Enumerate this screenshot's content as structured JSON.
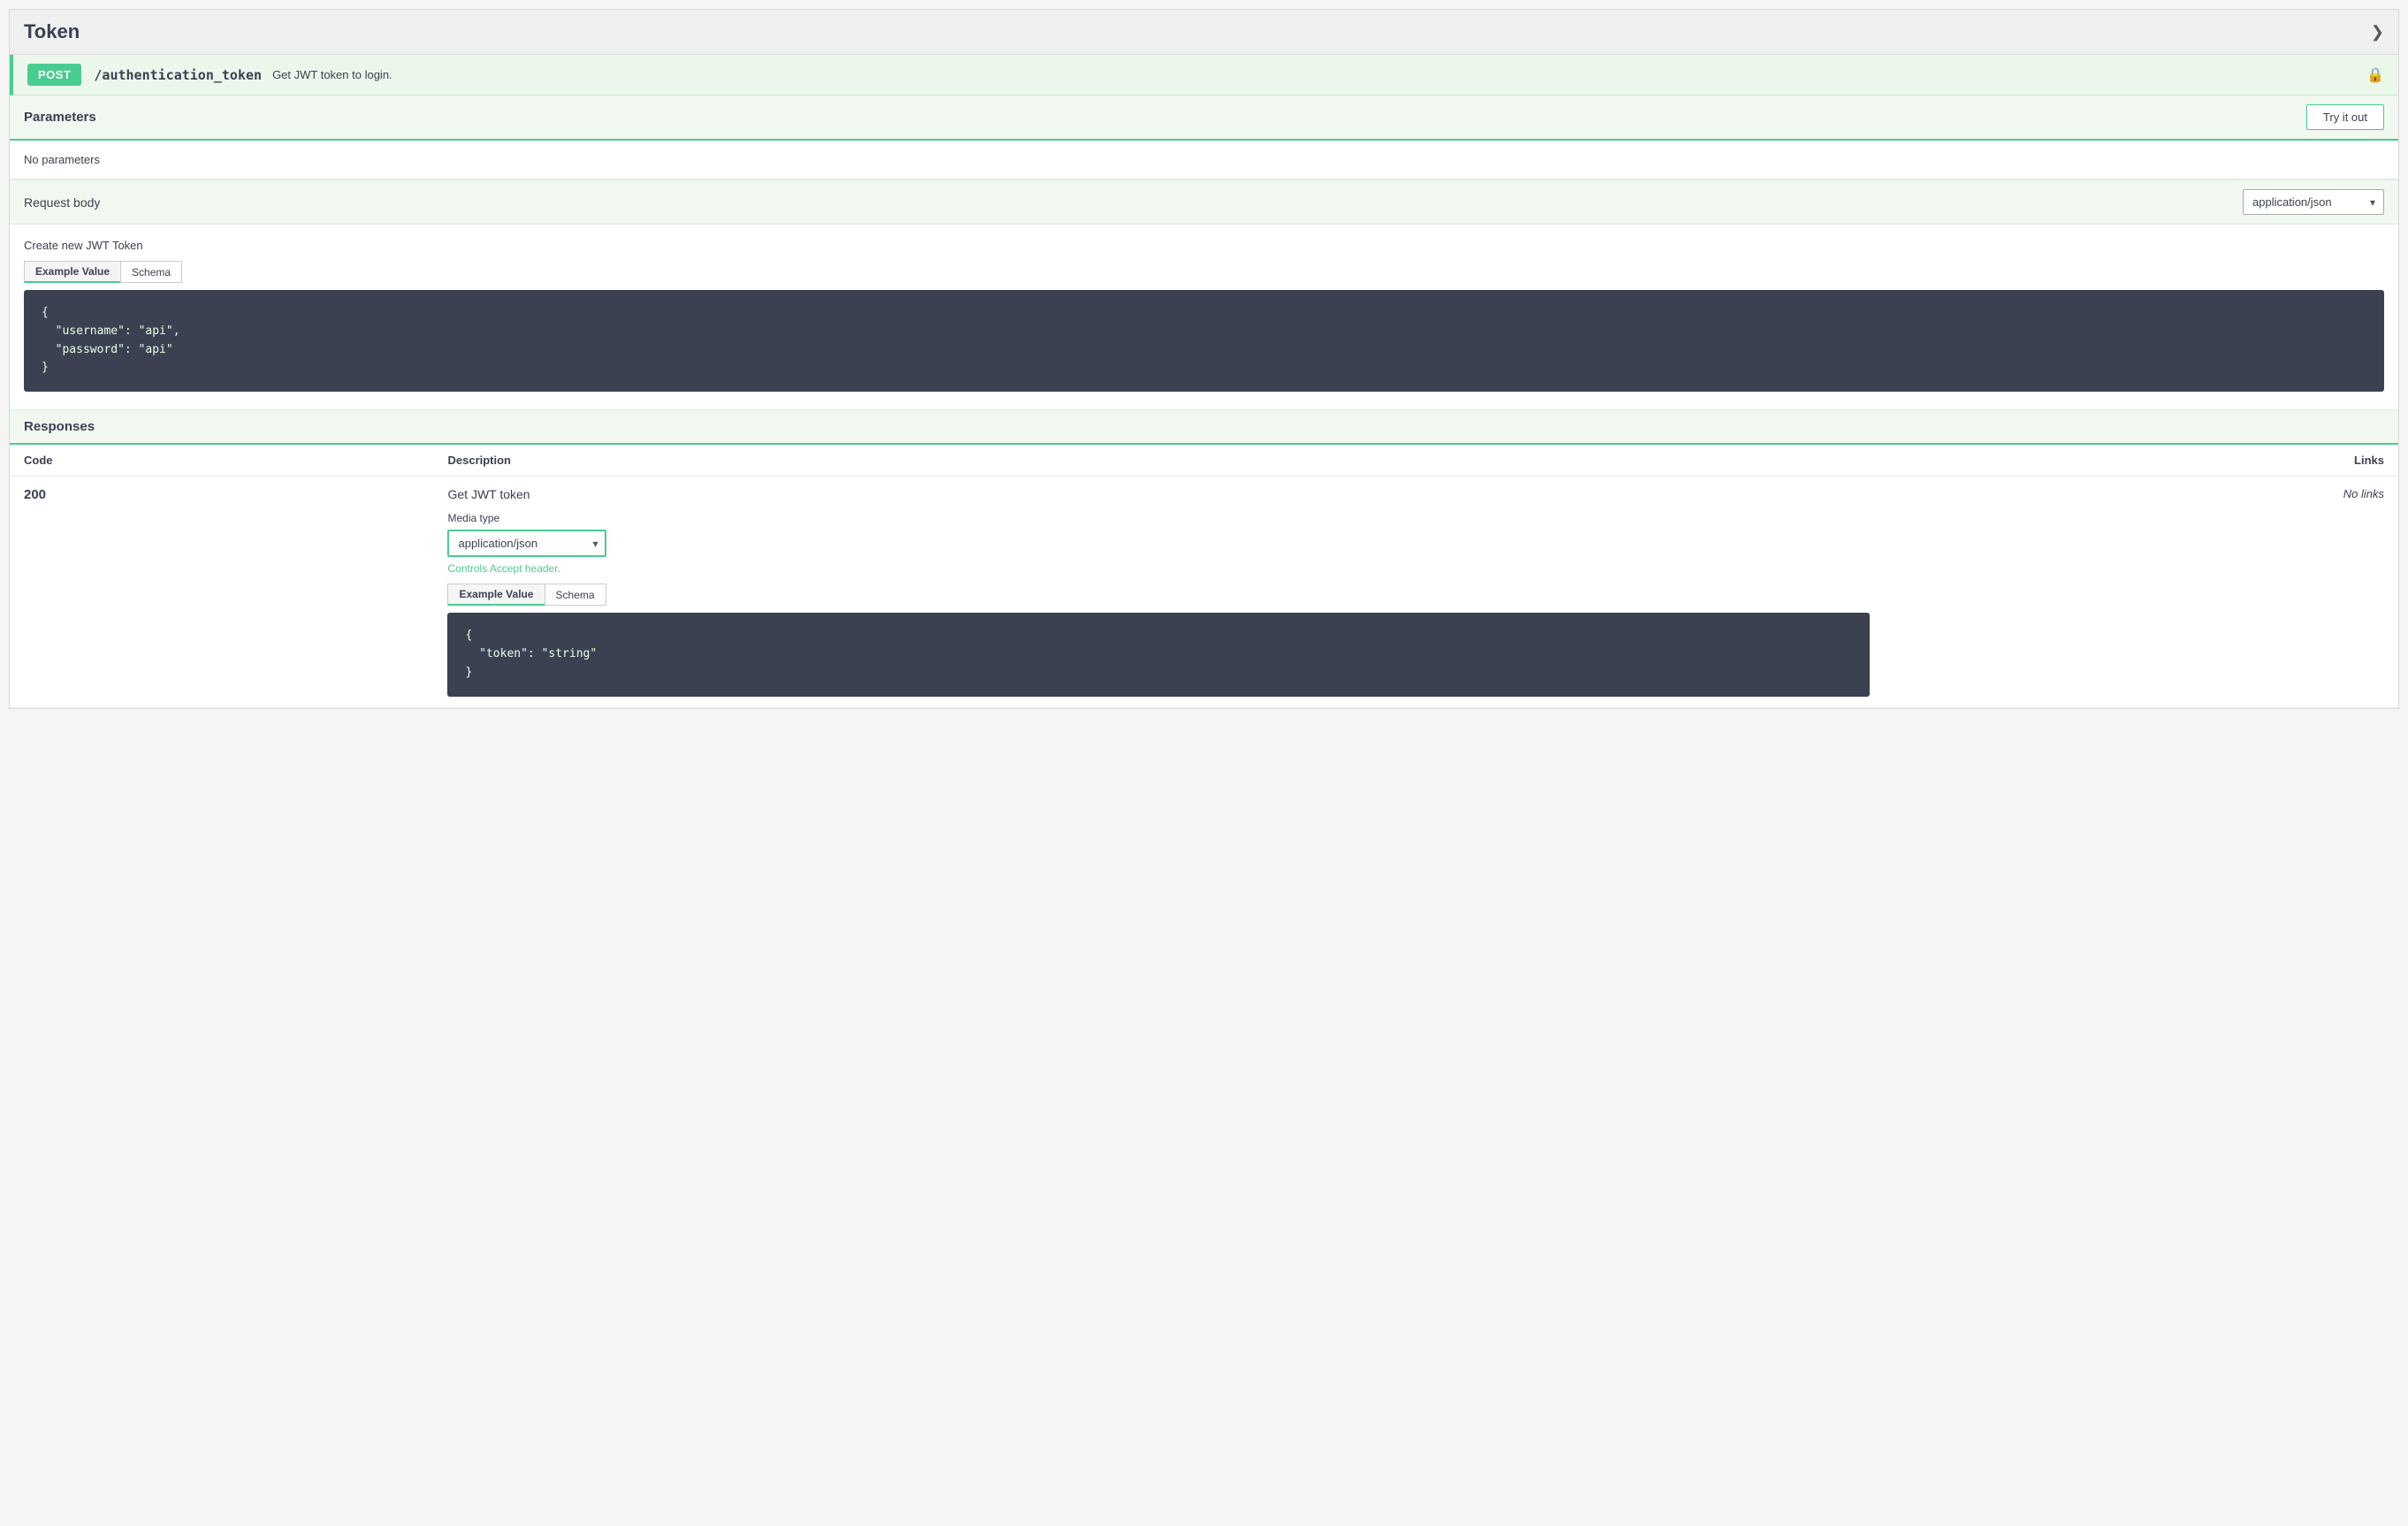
{
  "header": {
    "title": "Token",
    "collapse_icon": "❯"
  },
  "endpoint": {
    "method": "POST",
    "path": "/authentication_token",
    "description": "Get JWT token to login.",
    "lock_icon": "🔒"
  },
  "parameters": {
    "label": "Parameters",
    "try_it_out_label": "Try it out",
    "no_parameters_text": "No parameters"
  },
  "request_body": {
    "label": "Request body",
    "content_type": "application/json",
    "content_type_options": [
      "application/json"
    ]
  },
  "jwt_section": {
    "title": "Create new JWT Token",
    "tab_example": "Example Value",
    "tab_schema": "Schema",
    "code": "{\n  \"username\": \"api\",\n  \"password\": \"api\"\n}"
  },
  "responses": {
    "label": "Responses",
    "columns": {
      "code": "Code",
      "description": "Description",
      "links": "Links"
    },
    "rows": [
      {
        "code": "200",
        "description": "Get JWT token",
        "no_links": "No links",
        "media_type_label": "Media type",
        "media_type_value": "application/json",
        "controls_accept_text": "Controls Accept header.",
        "tab_example": "Example Value",
        "tab_schema": "Schema",
        "code_block": "{\n  \"token\": \"string\"\n}"
      }
    ]
  }
}
